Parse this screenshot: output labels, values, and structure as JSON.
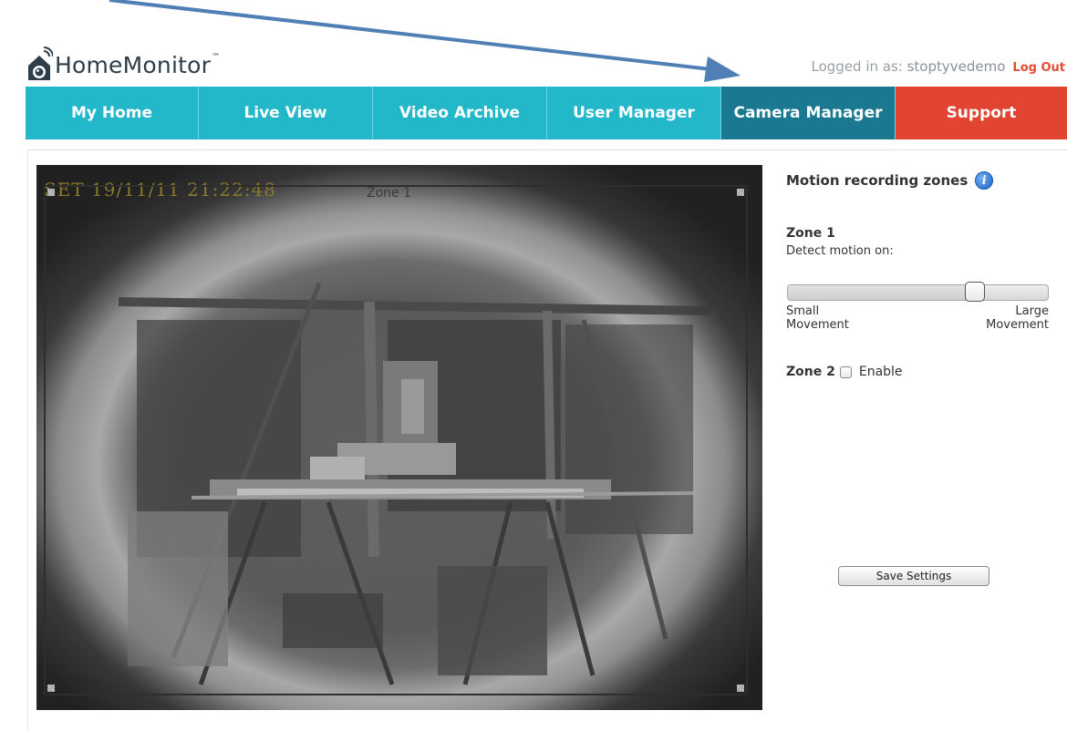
{
  "header": {
    "logo_text": "HomeMonitor",
    "logo_tm": "™",
    "logged_in_prefix": "Logged in as: ",
    "username": "stoptyvedemo",
    "logout_label": "Log Out"
  },
  "nav": {
    "items": [
      {
        "label": "My Home"
      },
      {
        "label": "Live View"
      },
      {
        "label": "Video Archive"
      },
      {
        "label": "User Manager"
      },
      {
        "label": "Camera Manager"
      },
      {
        "label": "Support"
      }
    ],
    "active_index": 4
  },
  "video": {
    "timestamp": "SET 19/11/11 21:22:48",
    "zone_label": "Zone 1"
  },
  "panel": {
    "title": "Motion recording zones",
    "info_icon": "i",
    "zone1_title": "Zone 1",
    "detect_label": "Detect motion on:",
    "slider_value": 0.72,
    "slider_min_label_1": "Small",
    "slider_min_label_2": "Movement",
    "slider_max_label_1": "Large",
    "slider_max_label_2": "Movement",
    "zone2_title": "Zone 2",
    "zone2_enable_label": "Enable",
    "zone2_enabled": false,
    "save_label": "Save Settings"
  },
  "colors": {
    "nav_bg": "#23b7ca",
    "nav_active": "#1a7891",
    "support_bg": "#e24432",
    "logout": "#e34b34",
    "annotation_arrow": "#4f7fb5"
  },
  "icons": {
    "logo": "house-camera-icon",
    "info": "info-icon",
    "arrow": "annotation-arrow-icon"
  }
}
